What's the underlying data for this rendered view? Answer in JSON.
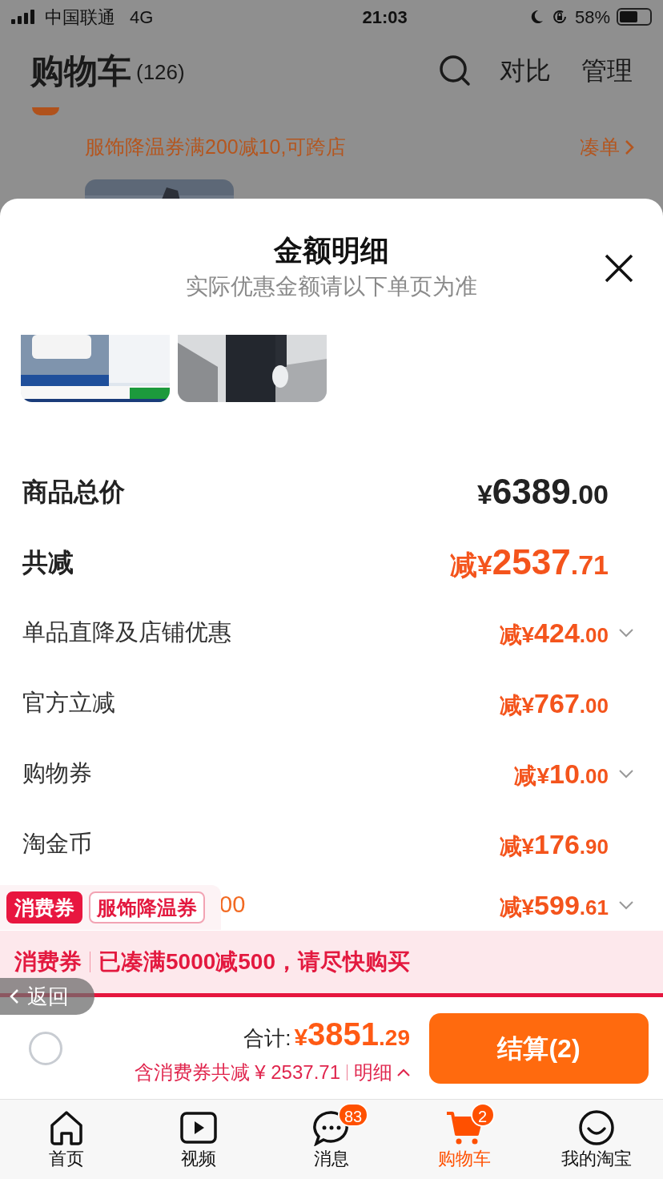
{
  "status_bar": {
    "carrier": "中国联通",
    "network": "4G",
    "time": "21:03",
    "battery": "58%"
  },
  "header": {
    "title": "购物车",
    "count": "(126)",
    "actions": [
      "对比",
      "管理"
    ]
  },
  "coupon_notice": {
    "text": "服饰降温券满200减10,可跨店",
    "link": "凑单"
  },
  "sheet": {
    "title": "金额明细",
    "subtitle": "实际优惠金额请以下单页为准",
    "rows": [
      {
        "kind": "total",
        "label": "商品总价",
        "prefix": "¥",
        "integer": "6389",
        "decimal": ".00",
        "expandable": false
      },
      {
        "kind": "emphasis",
        "label": "共减",
        "prefix": "减¥",
        "integer": "2537",
        "decimal": ".71",
        "expandable": false
      },
      {
        "kind": "detail",
        "label": "单品直降及店铺优惠",
        "prefix": "减¥",
        "integer": "424",
        "decimal": ".00",
        "expandable": true
      },
      {
        "kind": "detail",
        "label": "官方立减",
        "prefix": "减¥",
        "integer": "767",
        "decimal": ".00",
        "expandable": false
      },
      {
        "kind": "detail",
        "label": "购物券",
        "prefix": "减¥",
        "integer": "10",
        "decimal": ".00",
        "expandable": true
      },
      {
        "kind": "detail",
        "label": "淘金币",
        "prefix": "减¥",
        "integer": "176",
        "decimal": ".90",
        "expandable": false
      },
      {
        "kind": "detail",
        "label": "00",
        "prefix": "减¥",
        "integer": "599",
        "decimal": ".61",
        "expandable": true
      }
    ]
  },
  "coupon_tags": [
    {
      "text": "消费券",
      "kind": "filled"
    },
    {
      "text": "服饰降温券",
      "kind": "outline"
    }
  ],
  "banner": {
    "tag": "消费券",
    "message": "已凑满5000减500，请尽快购买"
  },
  "back_button": "返回",
  "footer": {
    "select_all_checked": false,
    "total_label": "合计:",
    "total_prefix": "¥",
    "total_integer": "3851",
    "total_decimal": ".29",
    "savings": "含消费券共减 ¥ 2537.71",
    "detail_link": "明细",
    "checkout": "结算(2)"
  },
  "tabs": [
    {
      "label": "首页",
      "selected": false
    },
    {
      "label": "视频",
      "selected": false
    },
    {
      "label": "消息",
      "selected": false,
      "badge": "83"
    },
    {
      "label": "购物车",
      "selected": true,
      "badge": "2"
    },
    {
      "label": "我的淘宝",
      "selected": false
    }
  ]
}
